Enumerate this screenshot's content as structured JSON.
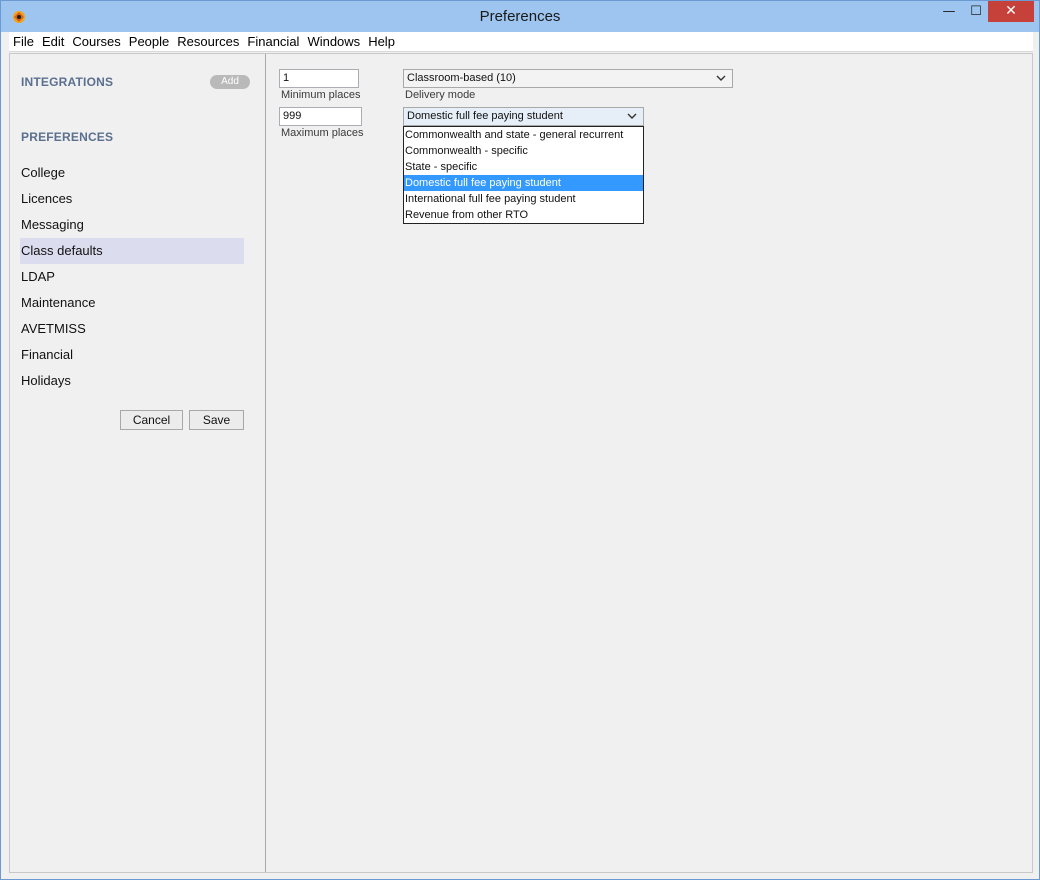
{
  "window": {
    "title": "Preferences",
    "controls": {
      "minimize": "—",
      "maximize": "☐",
      "close": "✕"
    }
  },
  "menu": [
    "File",
    "Edit",
    "Courses",
    "People",
    "Resources",
    "Financial",
    "Windows",
    "Help"
  ],
  "sidebar": {
    "integrations_header": "INTEGRATIONS",
    "add_label": "Add",
    "preferences_header": "PREFERENCES",
    "items": [
      {
        "label": "College",
        "active": false
      },
      {
        "label": "Licences",
        "active": false
      },
      {
        "label": "Messaging",
        "active": false
      },
      {
        "label": "Class defaults",
        "active": true
      },
      {
        "label": "LDAP",
        "active": false
      },
      {
        "label": "Maintenance",
        "active": false
      },
      {
        "label": "AVETMISS",
        "active": false
      },
      {
        "label": "Financial",
        "active": false
      },
      {
        "label": "Holidays",
        "active": false
      }
    ],
    "cancel_label": "Cancel",
    "save_label": "Save"
  },
  "form": {
    "min_places_value": "1",
    "min_places_label": "Minimum places",
    "max_places_value": "999",
    "max_places_label": "Maximum places",
    "delivery_mode_value": "Classroom-based (10)",
    "delivery_mode_label": "Delivery mode",
    "funding_value": "Domestic full fee paying student",
    "funding_options": [
      "Commonwealth and state - general recurrent",
      "Commonwealth - specific",
      "State - specific",
      "Domestic full fee paying student",
      "International full fee paying student",
      "Revenue from other RTO"
    ],
    "funding_selected_index": 3
  },
  "colors": {
    "selection": "#3399ff",
    "active_nav": "#dcdcef",
    "header_text": "#5b6f8f",
    "titlebar": "#9dc5ef",
    "close_button": "#c7413b"
  },
  "icons": {
    "app": "app-logo-icon",
    "chevron": "chevron-down-icon"
  }
}
